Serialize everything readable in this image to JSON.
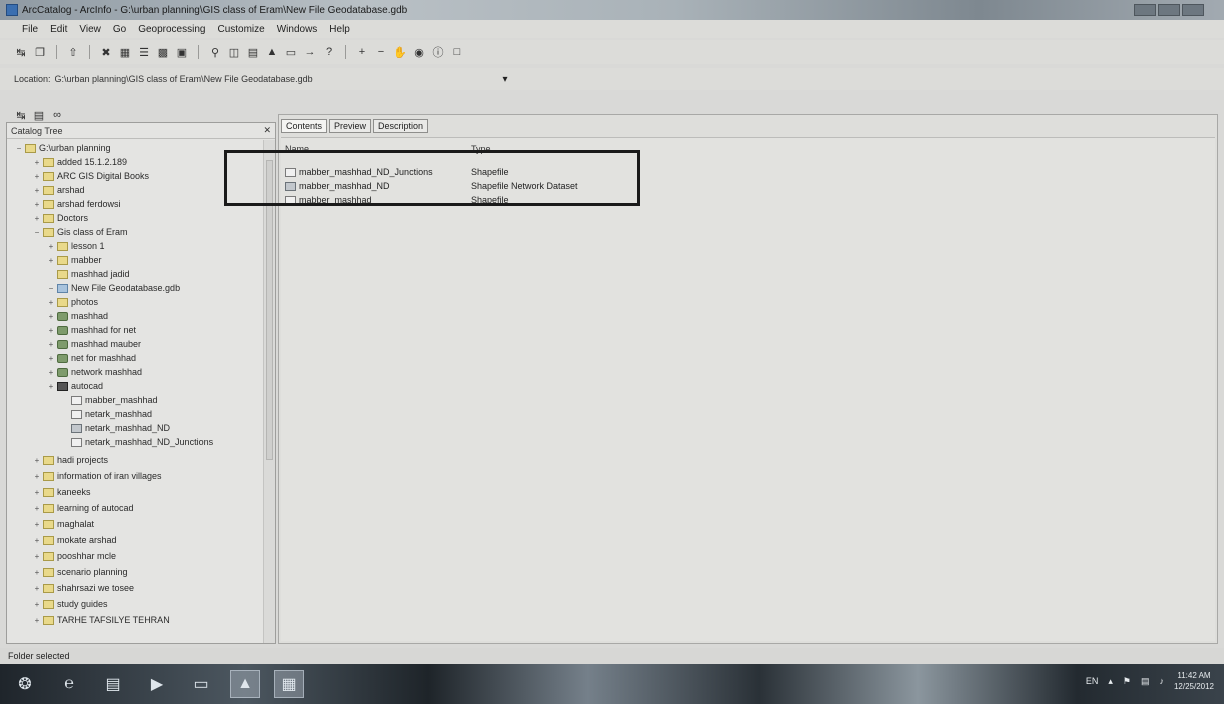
{
  "window": {
    "title": "ArcCatalog - ArcInfo - G:\\urban planning\\GIS class of Eram\\New File Geodatabase.gdb"
  },
  "menu": [
    "File",
    "Edit",
    "View",
    "Go",
    "Geoprocessing",
    "Customize",
    "Windows",
    "Help"
  ],
  "location": {
    "label": "Location:",
    "value": "G:\\urban planning\\GIS class of Eram\\New File Geodatabase.gdb"
  },
  "catalog_tree": {
    "title": "Catalog Tree",
    "close_label": "✕",
    "items": [
      {
        "label": "G:\\urban planning",
        "expander": "−",
        "icon": "folder"
      },
      {
        "label": "added 15.1.2.189",
        "expander": "+",
        "icon": "folder"
      },
      {
        "label": "ARC GIS Digital Books",
        "expander": "+",
        "icon": "folder"
      },
      {
        "label": "arshad",
        "expander": "+",
        "icon": "folder"
      },
      {
        "label": "arshad ferdowsi",
        "expander": "+",
        "icon": "folder"
      },
      {
        "label": "Doctors",
        "expander": "+",
        "icon": "folder"
      },
      {
        "label": "Gis class of Eram",
        "expander": "−",
        "icon": "folder"
      },
      {
        "label": "lesson 1",
        "expander": "+",
        "icon": "folder"
      },
      {
        "label": "mabber",
        "expander": "+",
        "icon": "folder"
      },
      {
        "label": "mashhad jadid",
        "expander": "",
        "icon": "folder"
      },
      {
        "label": "New File Geodatabase.gdb",
        "expander": "−",
        "icon": "gdb"
      },
      {
        "label": "photos",
        "expander": "+",
        "icon": "folder"
      },
      {
        "label": "mashhad",
        "expander": "+",
        "icon": "net"
      },
      {
        "label": "mashhad for net",
        "expander": "+",
        "icon": "net"
      },
      {
        "label": "mashhad mauber",
        "expander": "+",
        "icon": "net"
      },
      {
        "label": "net for mashhad",
        "expander": "+",
        "icon": "net"
      },
      {
        "label": "network mashhad",
        "expander": "+",
        "icon": "net"
      },
      {
        "label": "autocad",
        "expander": "+",
        "icon": "fc"
      },
      {
        "label": "mabber_mashhad",
        "expander": "",
        "icon": "shp"
      },
      {
        "label": "netark_mashhad",
        "expander": "",
        "icon": "shp"
      },
      {
        "label": "netark_mashhad_ND",
        "expander": "",
        "icon": "nd"
      },
      {
        "label": "netark_mashhad_ND_Junctions",
        "expander": "",
        "icon": "shp"
      },
      {
        "label": "hadi projects",
        "expander": "+",
        "icon": "folder"
      },
      {
        "label": "information of iran villages",
        "expander": "+",
        "icon": "folder"
      },
      {
        "label": "kaneeks",
        "expander": "+",
        "icon": "folder"
      },
      {
        "label": "learning of autocad",
        "expander": "+",
        "icon": "folder"
      },
      {
        "label": "maghalat",
        "expander": "+",
        "icon": "folder"
      },
      {
        "label": "mokate arshad",
        "expander": "+",
        "icon": "folder"
      },
      {
        "label": "pooshhar mcle",
        "expander": "+",
        "icon": "folder"
      },
      {
        "label": "scenario planning",
        "expander": "+",
        "icon": "folder"
      },
      {
        "label": "shahrsazi we tosee",
        "expander": "+",
        "icon": "folder"
      },
      {
        "label": "study guides",
        "expander": "+",
        "icon": "folder"
      },
      {
        "label": "TARHE TAFSILYE TEHRAN",
        "expander": "+",
        "icon": "folder"
      }
    ]
  },
  "content": {
    "tabs": [
      "Contents",
      "Preview",
      "Description"
    ],
    "columns": {
      "name": "Name",
      "type": "Type"
    },
    "rows": [
      {
        "name": "mabber_mashhad_ND_Junctions",
        "type": "Shapefile",
        "icon": "shp"
      },
      {
        "name": "mabber_mashhad_ND",
        "type": "Shapefile Network Dataset",
        "icon": "nd"
      },
      {
        "name": "mabber_mashhad",
        "type": "Shapefile",
        "icon": "shp"
      }
    ]
  },
  "status": {
    "text": "Folder selected"
  },
  "taskbar": {
    "language": "EN",
    "time": "11:42 AM",
    "date": "12/25/2012"
  }
}
